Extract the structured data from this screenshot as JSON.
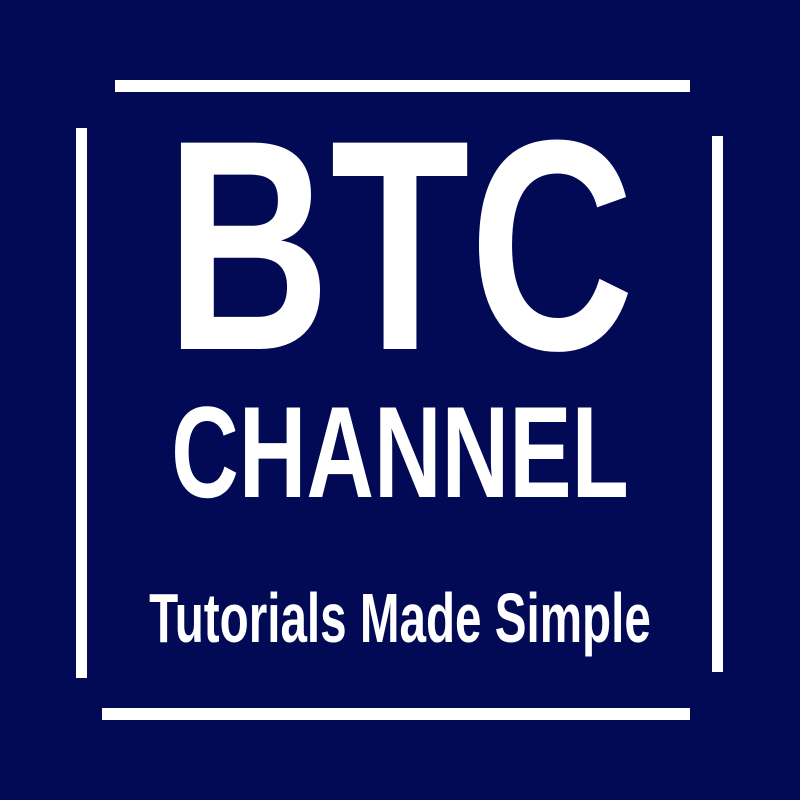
{
  "logo": {
    "title": "BTC",
    "subtitle": "CHANNEL",
    "tagline": "Tutorials Made Simple",
    "background_color": "#020a55",
    "foreground_color": "#ffffff"
  }
}
